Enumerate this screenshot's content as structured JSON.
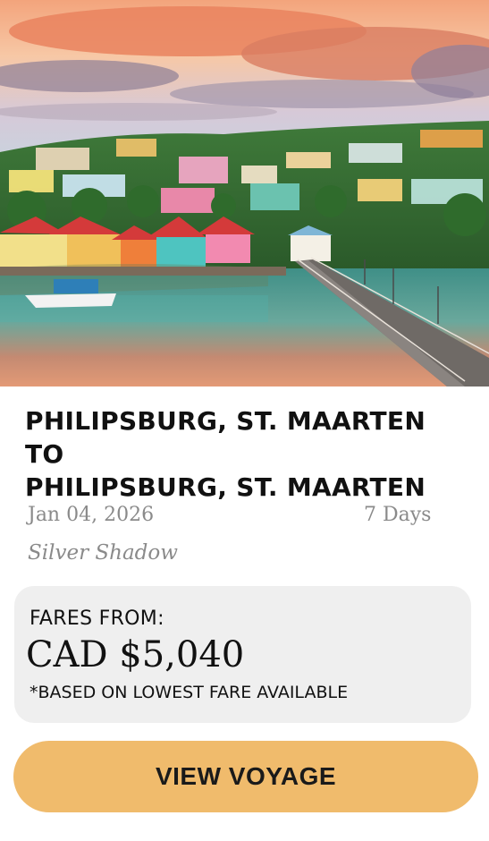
{
  "card": {
    "image_alt": "Colorful waterfront town with pier at sunset",
    "title_line1": "PHILIPSBURG, ST. MAARTEN TO",
    "title_line2": "PHILIPSBURG, ST. MAARTEN",
    "date": "Jan 04, 2026",
    "duration": "7 Days",
    "ship": "Silver Shadow",
    "fares": {
      "label": "FARES FROM:",
      "price": "CAD $5,040",
      "note": "*BASED ON LOWEST FARE AVAILABLE"
    },
    "cta_label": "VIEW VOYAGE"
  },
  "colors": {
    "cta_background": "#f0bb6c",
    "fare_box_background": "#efefef",
    "meta_text": "#8a8a8a"
  }
}
